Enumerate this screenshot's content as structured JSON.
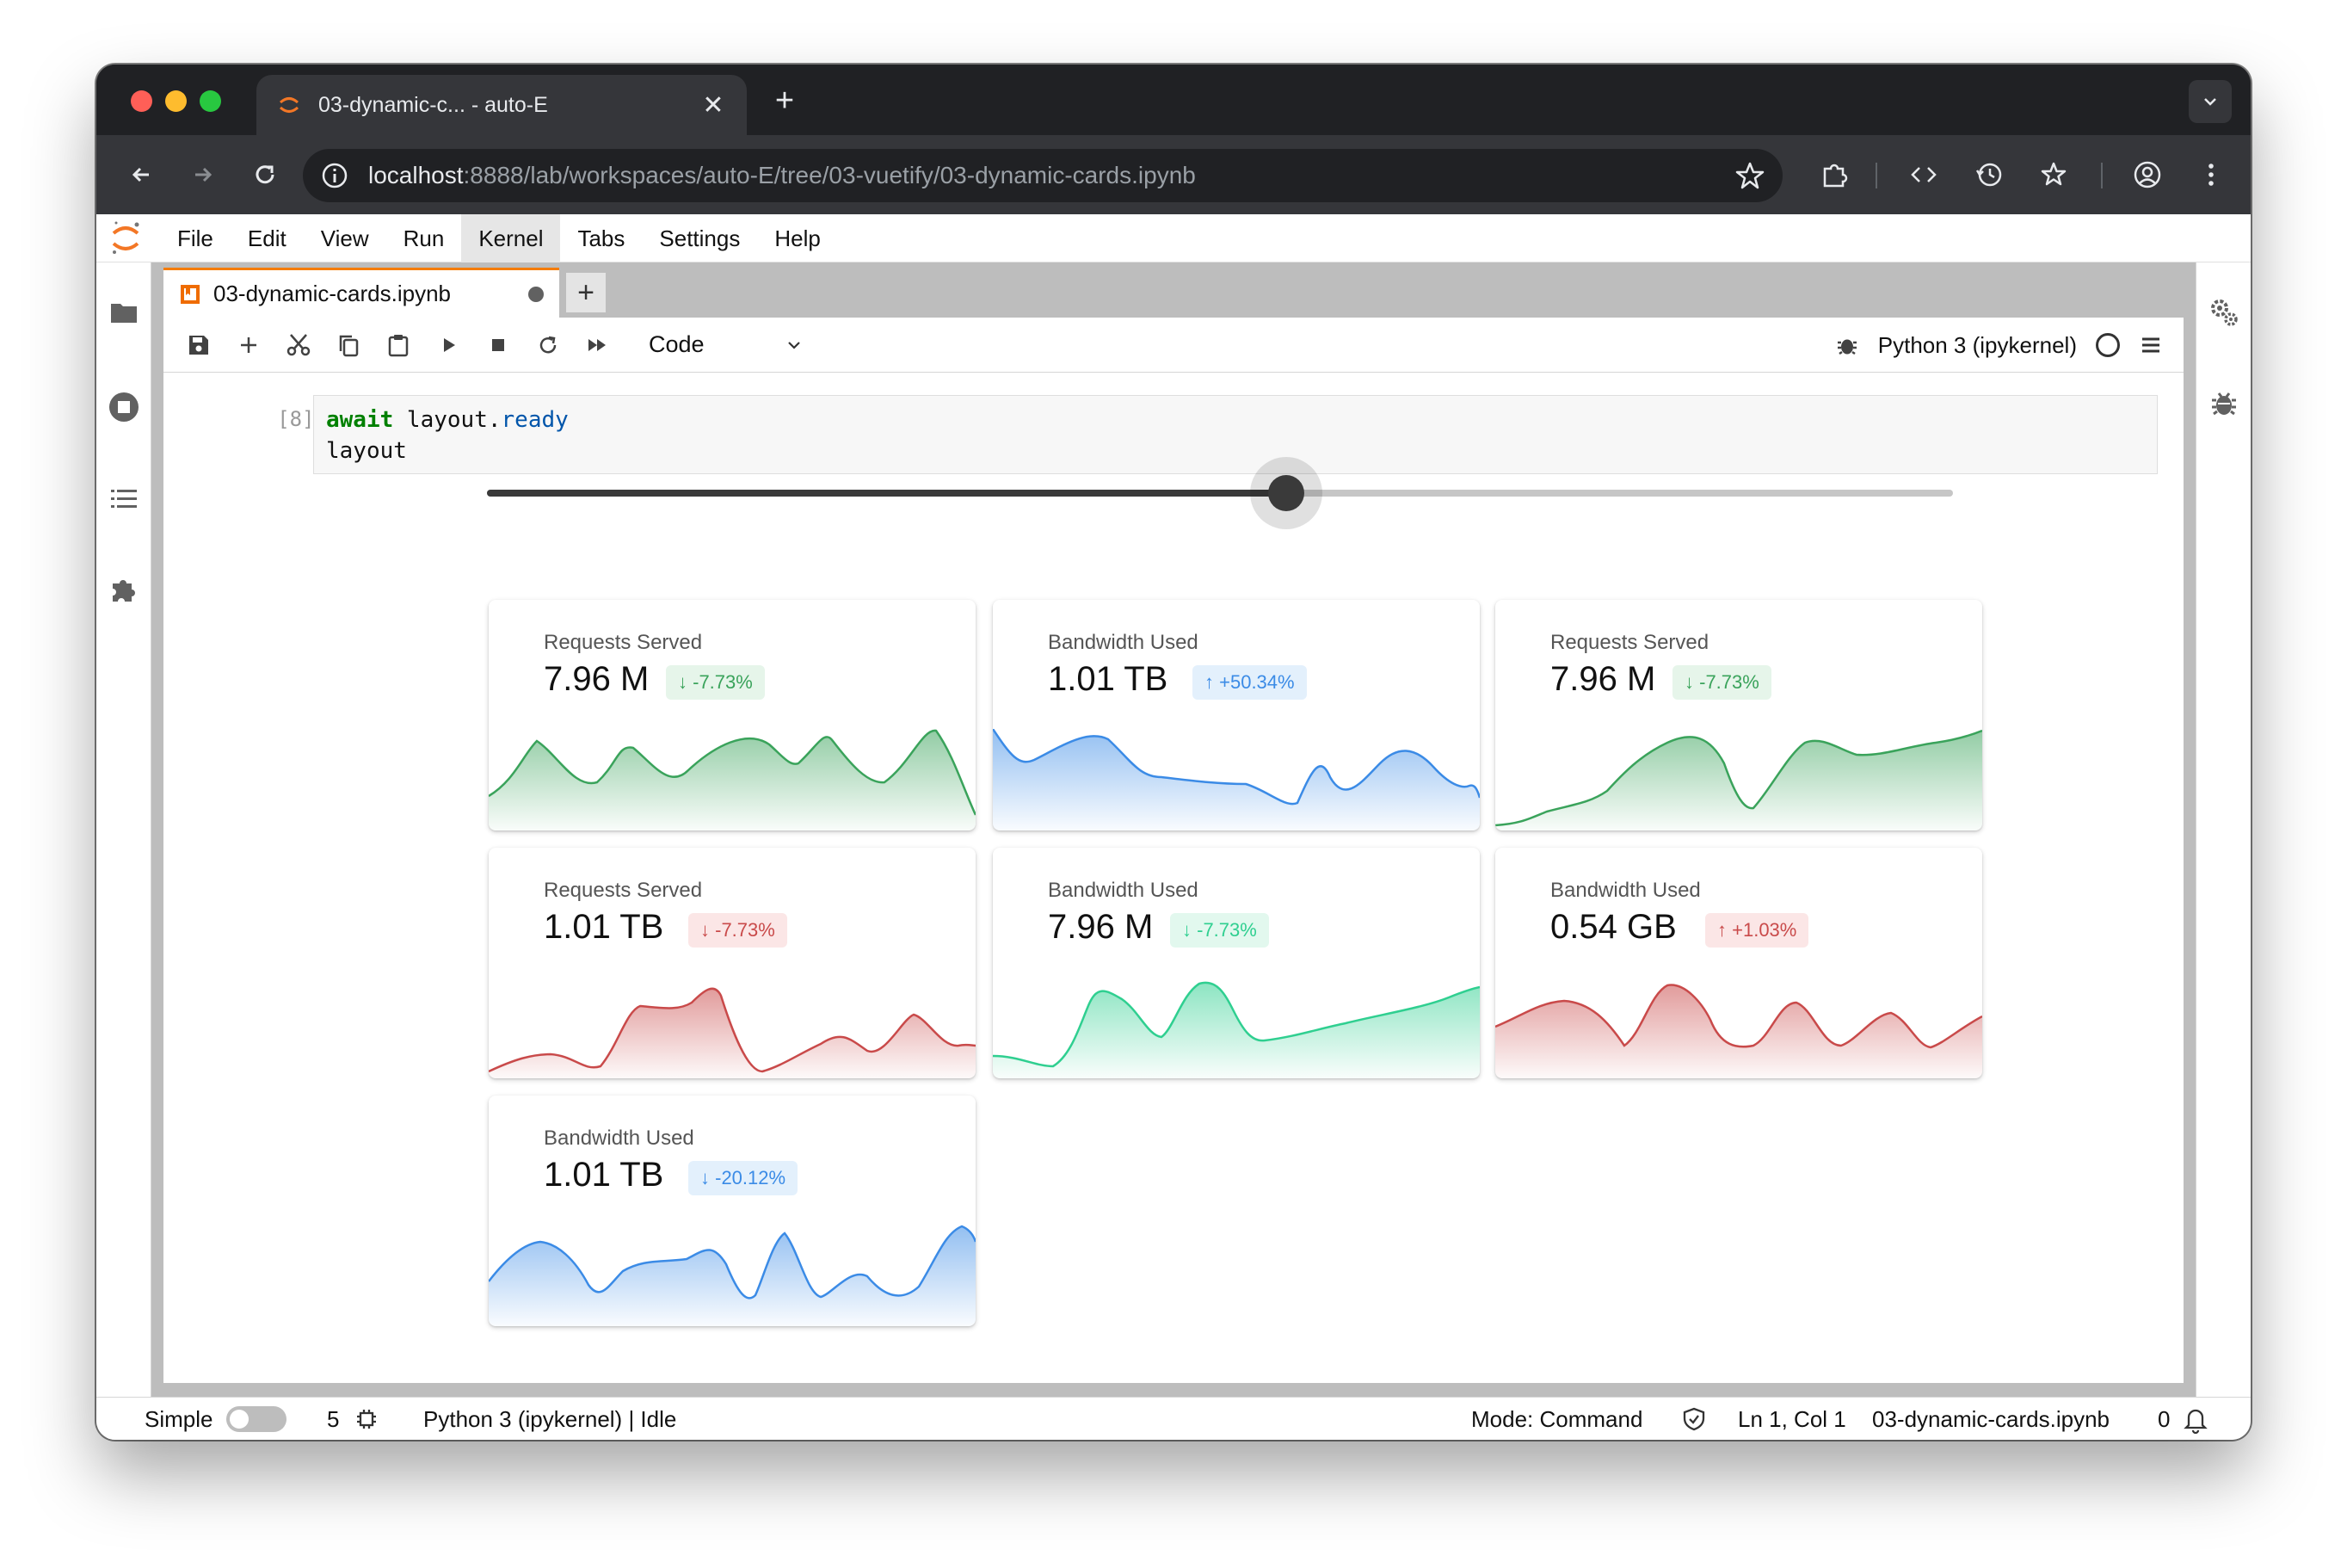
{
  "browser": {
    "tab_title": "03-dynamic-c... - auto-E",
    "url_host": "localhost",
    "url_rest": ":8888/lab/workspaces/auto-E/tree/03-vuetify/03-dynamic-cards.ipynb"
  },
  "menu": {
    "file": "File",
    "edit": "Edit",
    "view": "View",
    "run": "Run",
    "kernel": "Kernel",
    "tabs": "Tabs",
    "settings": "Settings",
    "help": "Help"
  },
  "notebook": {
    "tab_title": "03-dynamic-cards.ipynb",
    "cell_type": "Code",
    "kernel_name": "Python 3 (ipykernel)",
    "cell_prompt": "[8]:",
    "code_kw": "await",
    "code_obj": " layout.",
    "code_attr": "ready",
    "code_line2": "layout"
  },
  "slider": {
    "value_fraction": 0.545
  },
  "colors": {
    "green": "#3aa35b",
    "blue": "#3b8be6",
    "red": "#c94a4a",
    "teal": "#2fcf90",
    "badge_green_bg": "#e6f5ea",
    "badge_blue_bg": "#e3f0fc",
    "badge_red_bg": "#fbe6e6",
    "badge_teal_bg": "#e2f8ee"
  },
  "cards": [
    {
      "title": "Requests Served",
      "value": "7.96 M",
      "change": "-7.73%",
      "direction": "down",
      "color": "green"
    },
    {
      "title": "Bandwidth Used",
      "value": "1.01 TB",
      "change": "+50.34%",
      "direction": "up",
      "color": "blue"
    },
    {
      "title": "Requests Served",
      "value": "7.96 M",
      "change": "-7.73%",
      "direction": "down",
      "color": "green"
    },
    {
      "title": "Requests Served",
      "value": "1.01 TB",
      "change": "-7.73%",
      "direction": "down",
      "color": "red"
    },
    {
      "title": "Bandwidth Used",
      "value": "7.96 M",
      "change": "-7.73%",
      "direction": "down",
      "color": "teal"
    },
    {
      "title": "Bandwidth Used",
      "value": "0.54 GB",
      "change": "+1.03%",
      "direction": "up",
      "color": "red"
    },
    {
      "title": "Bandwidth Used",
      "value": "1.01 TB",
      "change": "-20.12%",
      "direction": "down",
      "color": "blue"
    }
  ],
  "statusbar": {
    "simple_label": "Simple",
    "terminals_count": "5",
    "kernel_status": "Python 3 (ipykernel) | Idle",
    "mode": "Mode: Command",
    "cursor": "Ln 1, Col 1",
    "filename": "03-dynamic-cards.ipynb",
    "notifications": "0"
  }
}
